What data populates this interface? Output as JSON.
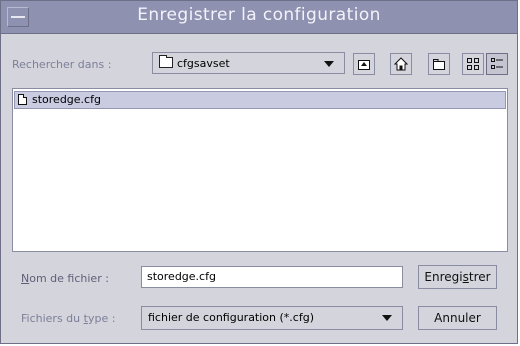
{
  "window": {
    "title": "Enregistrer la configuration"
  },
  "look_in": {
    "label": "Rechercher dans :",
    "selected": "cfgsavset"
  },
  "toolbar": {
    "up_icon": "up-folder",
    "home_icon": "home",
    "new_folder_icon": "new-folder",
    "list_view_icon": "list-view",
    "details_view_icon": "details-view"
  },
  "files": [
    {
      "name": "storedge.cfg",
      "selected": true
    }
  ],
  "filename": {
    "label": "Nom de fichier :",
    "label_mnemonic": "N",
    "label_rest": "om de fichier :",
    "value": "storedge.cfg"
  },
  "filetype": {
    "label_pre": "Fichiers du ",
    "label_mnemonic": "t",
    "label_post": "ype :",
    "selected": "fichier de configuration (*.cfg)"
  },
  "buttons": {
    "save_pre": "Enregi",
    "save_mnemonic": "s",
    "save_post": "trer",
    "cancel": "Annuler"
  }
}
